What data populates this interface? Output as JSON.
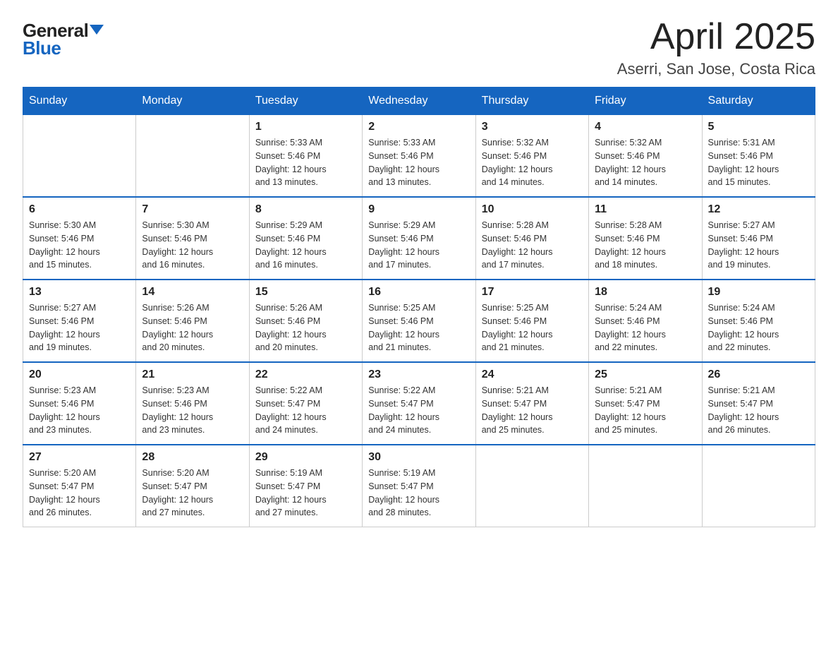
{
  "logo": {
    "general": "General",
    "blue": "Blue"
  },
  "title": {
    "month_year": "April 2025",
    "location": "Aserri, San Jose, Costa Rica"
  },
  "weekdays": [
    "Sunday",
    "Monday",
    "Tuesday",
    "Wednesday",
    "Thursday",
    "Friday",
    "Saturday"
  ],
  "weeks": [
    [
      {
        "day": "",
        "info": ""
      },
      {
        "day": "",
        "info": ""
      },
      {
        "day": "1",
        "info": "Sunrise: 5:33 AM\nSunset: 5:46 PM\nDaylight: 12 hours\nand 13 minutes."
      },
      {
        "day": "2",
        "info": "Sunrise: 5:33 AM\nSunset: 5:46 PM\nDaylight: 12 hours\nand 13 minutes."
      },
      {
        "day": "3",
        "info": "Sunrise: 5:32 AM\nSunset: 5:46 PM\nDaylight: 12 hours\nand 14 minutes."
      },
      {
        "day": "4",
        "info": "Sunrise: 5:32 AM\nSunset: 5:46 PM\nDaylight: 12 hours\nand 14 minutes."
      },
      {
        "day": "5",
        "info": "Sunrise: 5:31 AM\nSunset: 5:46 PM\nDaylight: 12 hours\nand 15 minutes."
      }
    ],
    [
      {
        "day": "6",
        "info": "Sunrise: 5:30 AM\nSunset: 5:46 PM\nDaylight: 12 hours\nand 15 minutes."
      },
      {
        "day": "7",
        "info": "Sunrise: 5:30 AM\nSunset: 5:46 PM\nDaylight: 12 hours\nand 16 minutes."
      },
      {
        "day": "8",
        "info": "Sunrise: 5:29 AM\nSunset: 5:46 PM\nDaylight: 12 hours\nand 16 minutes."
      },
      {
        "day": "9",
        "info": "Sunrise: 5:29 AM\nSunset: 5:46 PM\nDaylight: 12 hours\nand 17 minutes."
      },
      {
        "day": "10",
        "info": "Sunrise: 5:28 AM\nSunset: 5:46 PM\nDaylight: 12 hours\nand 17 minutes."
      },
      {
        "day": "11",
        "info": "Sunrise: 5:28 AM\nSunset: 5:46 PM\nDaylight: 12 hours\nand 18 minutes."
      },
      {
        "day": "12",
        "info": "Sunrise: 5:27 AM\nSunset: 5:46 PM\nDaylight: 12 hours\nand 19 minutes."
      }
    ],
    [
      {
        "day": "13",
        "info": "Sunrise: 5:27 AM\nSunset: 5:46 PM\nDaylight: 12 hours\nand 19 minutes."
      },
      {
        "day": "14",
        "info": "Sunrise: 5:26 AM\nSunset: 5:46 PM\nDaylight: 12 hours\nand 20 minutes."
      },
      {
        "day": "15",
        "info": "Sunrise: 5:26 AM\nSunset: 5:46 PM\nDaylight: 12 hours\nand 20 minutes."
      },
      {
        "day": "16",
        "info": "Sunrise: 5:25 AM\nSunset: 5:46 PM\nDaylight: 12 hours\nand 21 minutes."
      },
      {
        "day": "17",
        "info": "Sunrise: 5:25 AM\nSunset: 5:46 PM\nDaylight: 12 hours\nand 21 minutes."
      },
      {
        "day": "18",
        "info": "Sunrise: 5:24 AM\nSunset: 5:46 PM\nDaylight: 12 hours\nand 22 minutes."
      },
      {
        "day": "19",
        "info": "Sunrise: 5:24 AM\nSunset: 5:46 PM\nDaylight: 12 hours\nand 22 minutes."
      }
    ],
    [
      {
        "day": "20",
        "info": "Sunrise: 5:23 AM\nSunset: 5:46 PM\nDaylight: 12 hours\nand 23 minutes."
      },
      {
        "day": "21",
        "info": "Sunrise: 5:23 AM\nSunset: 5:46 PM\nDaylight: 12 hours\nand 23 minutes."
      },
      {
        "day": "22",
        "info": "Sunrise: 5:22 AM\nSunset: 5:47 PM\nDaylight: 12 hours\nand 24 minutes."
      },
      {
        "day": "23",
        "info": "Sunrise: 5:22 AM\nSunset: 5:47 PM\nDaylight: 12 hours\nand 24 minutes."
      },
      {
        "day": "24",
        "info": "Sunrise: 5:21 AM\nSunset: 5:47 PM\nDaylight: 12 hours\nand 25 minutes."
      },
      {
        "day": "25",
        "info": "Sunrise: 5:21 AM\nSunset: 5:47 PM\nDaylight: 12 hours\nand 25 minutes."
      },
      {
        "day": "26",
        "info": "Sunrise: 5:21 AM\nSunset: 5:47 PM\nDaylight: 12 hours\nand 26 minutes."
      }
    ],
    [
      {
        "day": "27",
        "info": "Sunrise: 5:20 AM\nSunset: 5:47 PM\nDaylight: 12 hours\nand 26 minutes."
      },
      {
        "day": "28",
        "info": "Sunrise: 5:20 AM\nSunset: 5:47 PM\nDaylight: 12 hours\nand 27 minutes."
      },
      {
        "day": "29",
        "info": "Sunrise: 5:19 AM\nSunset: 5:47 PM\nDaylight: 12 hours\nand 27 minutes."
      },
      {
        "day": "30",
        "info": "Sunrise: 5:19 AM\nSunset: 5:47 PM\nDaylight: 12 hours\nand 28 minutes."
      },
      {
        "day": "",
        "info": ""
      },
      {
        "day": "",
        "info": ""
      },
      {
        "day": "",
        "info": ""
      }
    ]
  ]
}
